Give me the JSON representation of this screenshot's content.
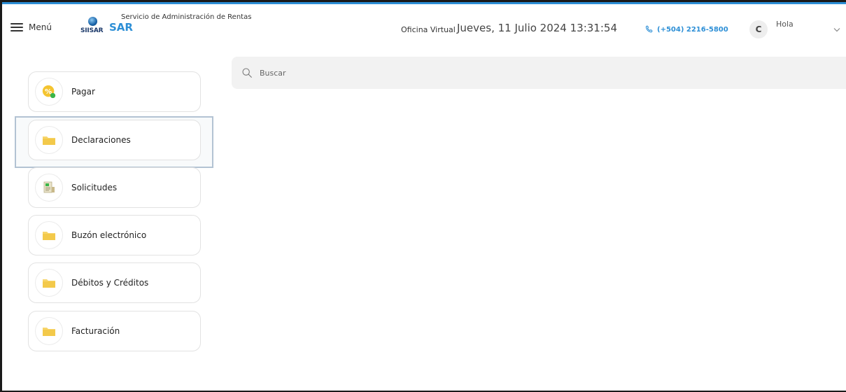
{
  "header": {
    "menu_label": "Menú",
    "logo_text": "SIISAR",
    "agency_name": "Servicio de Administración de Rentas",
    "agency_short": "SAR",
    "office_label": "Oficina Virtual",
    "datetime": "Jueves, 11 Julio 2024 13:31:54",
    "phone": "(+504) 2216-5800",
    "avatar_initial": "C",
    "greeting": "Hola"
  },
  "search": {
    "placeholder": "Buscar",
    "value": ""
  },
  "sidebar": {
    "items": [
      {
        "label": "Pagar",
        "icon": "payment-icon"
      },
      {
        "label": "Declaraciones",
        "icon": "folder-icon"
      },
      {
        "label": "Solicitudes",
        "icon": "document-icon"
      },
      {
        "label": "Buzón electrónico",
        "icon": "folder-icon"
      },
      {
        "label": "Débitos y Créditos",
        "icon": "folder-icon"
      },
      {
        "label": "Facturación",
        "icon": "folder-icon"
      }
    ]
  },
  "colors": {
    "accent": "#2d8fd6",
    "folder": "#f7d56a",
    "search_bg": "#f2f2f2"
  }
}
